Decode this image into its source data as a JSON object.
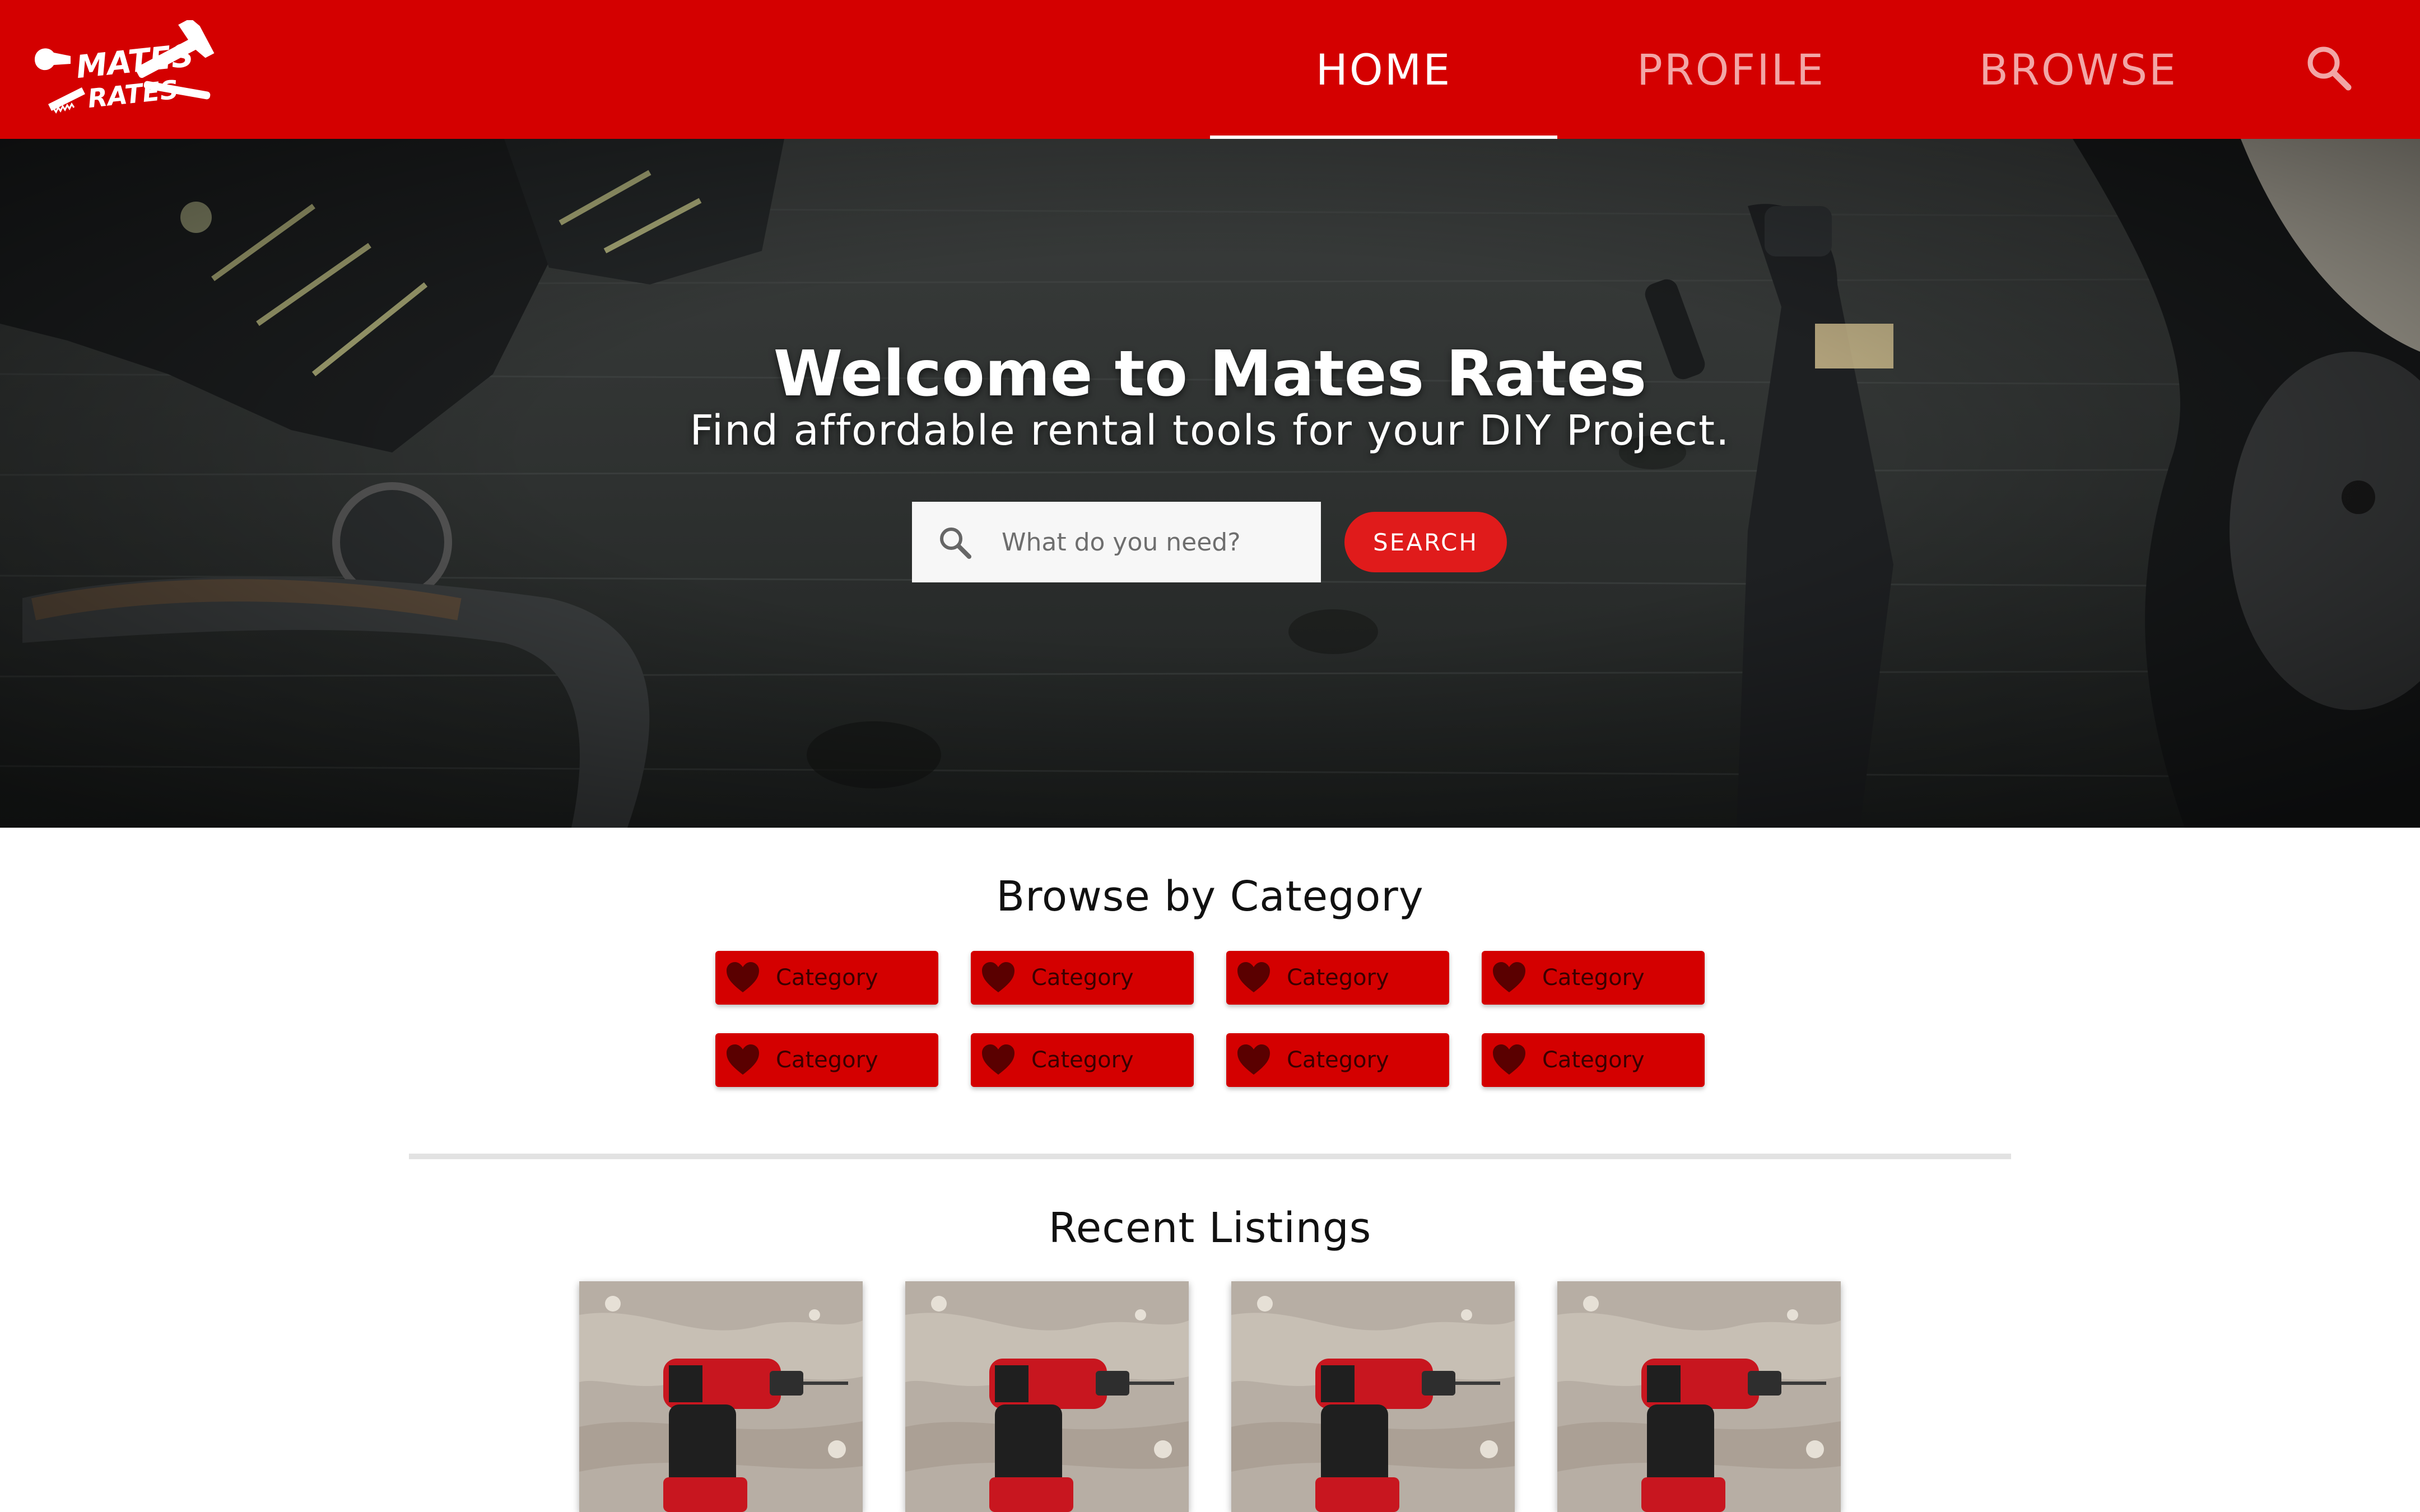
{
  "brand": {
    "logo_line1": "MATES",
    "logo_line2": "RATES",
    "primary_color": "#d40000",
    "button_red": "#e01b1b"
  },
  "nav": {
    "items": [
      {
        "label": "HOME",
        "active": true
      },
      {
        "label": "PROFILE",
        "active": false
      },
      {
        "label": "BROWSE",
        "active": false
      }
    ],
    "search_icon": "search-icon"
  },
  "hero": {
    "title": "Welcome to Mates Rates",
    "subtitle": "Find affordable rental tools for your DIY Project.",
    "search_placeholder": "What do you need?",
    "search_value": "",
    "search_button": "SEARCH"
  },
  "categories": {
    "title": "Browse by Category",
    "icon": "heart-icon",
    "items": [
      {
        "label": "Category"
      },
      {
        "label": "Category"
      },
      {
        "label": "Category"
      },
      {
        "label": "Category"
      },
      {
        "label": "Category"
      },
      {
        "label": "Category"
      },
      {
        "label": "Category"
      },
      {
        "label": "Category"
      }
    ]
  },
  "listings": {
    "title": "Recent Listings",
    "items": [
      {
        "image": "drill-photo"
      },
      {
        "image": "drill-photo"
      },
      {
        "image": "drill-photo"
      },
      {
        "image": "drill-photo"
      }
    ]
  }
}
